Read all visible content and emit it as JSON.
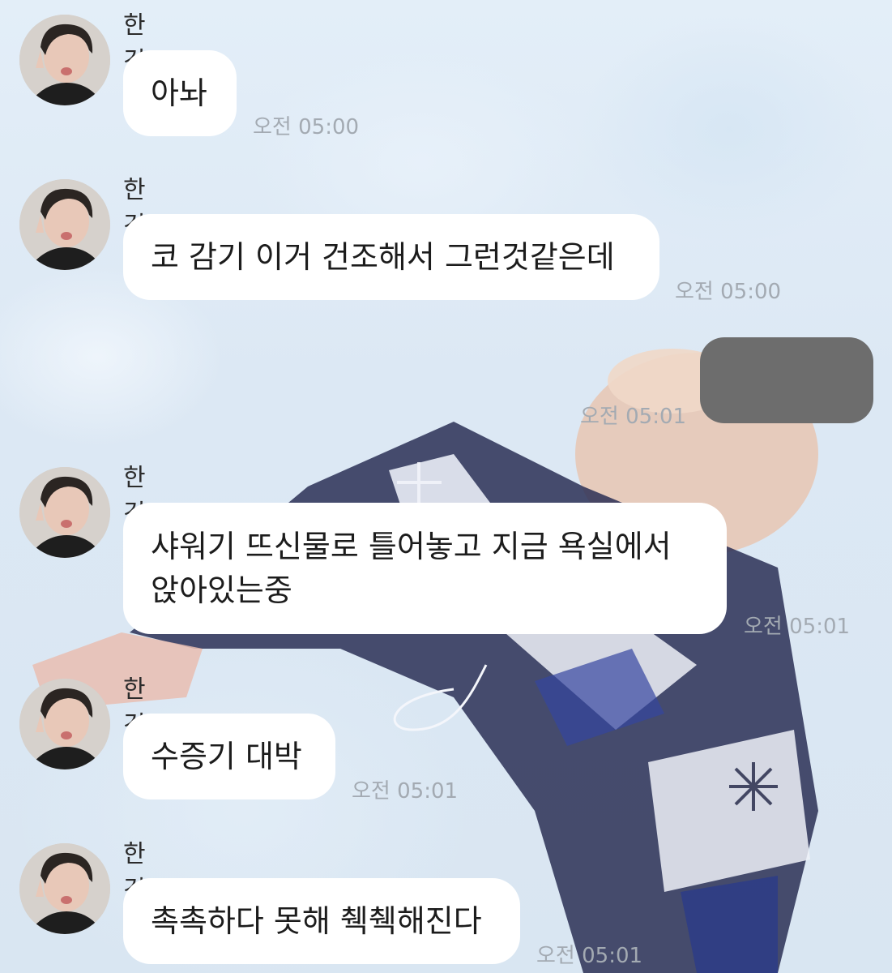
{
  "chat": {
    "messages": [
      {
        "sender": "한건강",
        "text": "아놔",
        "time": "오전 05:00"
      },
      {
        "sender": "한건강",
        "text": "코 감기 이거 건조해서 그런것같은데",
        "time": "오전 05:00"
      },
      {
        "sender": "",
        "text": "",
        "time": "오전 05:01",
        "redacted": true
      },
      {
        "sender": "한건강",
        "lines": [
          "샤워기 뜨신물로 틀어놓고 지금 욕실에서",
          "앉아있는중"
        ],
        "time": "오전 05:01"
      },
      {
        "sender": "한건강",
        "text": "수증기 대박",
        "time": "오전 05:01"
      },
      {
        "sender": "한건강",
        "text": "촉촉하다 못해 췍췍해진다",
        "time": "오전 05:01"
      }
    ]
  },
  "colors": {
    "bubble_other": "#ffffff",
    "bubble_mine": "#6d6d6d",
    "timestamp": "#a3aab2",
    "sender_name": "#2b2b2b",
    "background": "#dfeaf4"
  },
  "icons": {
    "avatar": "profile-photo"
  }
}
